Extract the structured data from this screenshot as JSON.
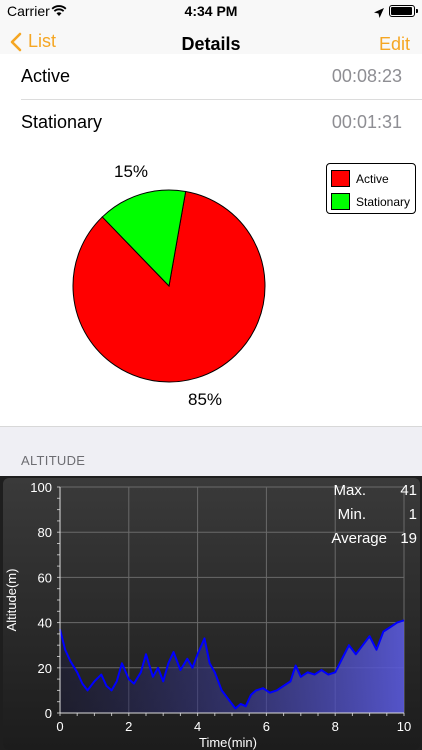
{
  "status_bar": {
    "carrier": "Carrier",
    "time": "4:34 PM"
  },
  "nav": {
    "back_label": "List",
    "title": "Details",
    "edit_label": "Edit"
  },
  "rows": [
    {
      "label": "Active",
      "value": "00:08:23"
    },
    {
      "label": "Stationary",
      "value": "00:01:31"
    }
  ],
  "pie": {
    "slices": [
      {
        "name": "Active",
        "percent": 85,
        "label": "85%",
        "color": "#ff0000"
      },
      {
        "name": "Stationary",
        "percent": 15,
        "label": "15%",
        "color": "#00ff00"
      }
    ]
  },
  "altitude": {
    "section_header": "ALTITUDE",
    "stats": [
      {
        "label": "Max.",
        "value": "41"
      },
      {
        "label": "Min.",
        "value": "1"
      },
      {
        "label": "Average",
        "value": "19"
      }
    ]
  },
  "chart_data": {
    "type": "area",
    "xlabel": "Time(min)",
    "ylabel": "Altitude(m)",
    "xlim": [
      0,
      10
    ],
    "ylim": [
      0,
      100
    ],
    "x_ticks": [
      "0",
      "2",
      "4",
      "6",
      "8",
      "10"
    ],
    "y_ticks": [
      "0",
      "20",
      "40",
      "60",
      "80",
      "100"
    ],
    "grid": true,
    "line_color": "#0000ff",
    "series": [
      {
        "x": [
          0,
          0.15,
          0.3,
          0.5,
          0.65,
          0.8,
          1.0,
          1.2,
          1.35,
          1.5,
          1.65,
          1.8,
          2.0,
          2.15,
          2.35,
          2.5,
          2.7,
          2.85,
          3.0,
          3.15,
          3.3,
          3.5,
          3.7,
          3.85,
          4.0,
          4.2,
          4.35,
          4.5,
          4.7,
          4.9,
          5.1,
          5.25,
          5.4,
          5.55,
          5.7,
          5.9,
          6.1,
          6.3,
          6.5,
          6.7,
          6.85,
          7.0,
          7.2,
          7.4,
          7.6,
          7.8,
          8.0,
          8.2,
          8.4,
          8.6,
          8.8,
          9.0,
          9.2,
          9.4,
          9.6,
          9.8,
          10.0
        ],
        "y": [
          37,
          28,
          23,
          18,
          13,
          10,
          14,
          17,
          12,
          10,
          14,
          22,
          15,
          13,
          18,
          26,
          16,
          20,
          14,
          22,
          27,
          19,
          24,
          20,
          26,
          33,
          22,
          18,
          10,
          6,
          2,
          4,
          3,
          8,
          10,
          11,
          9,
          10,
          12,
          14,
          21,
          16,
          18,
          17,
          19,
          17,
          18,
          24,
          30,
          26,
          30,
          34,
          28,
          36,
          38,
          40,
          41
        ]
      }
    ]
  }
}
